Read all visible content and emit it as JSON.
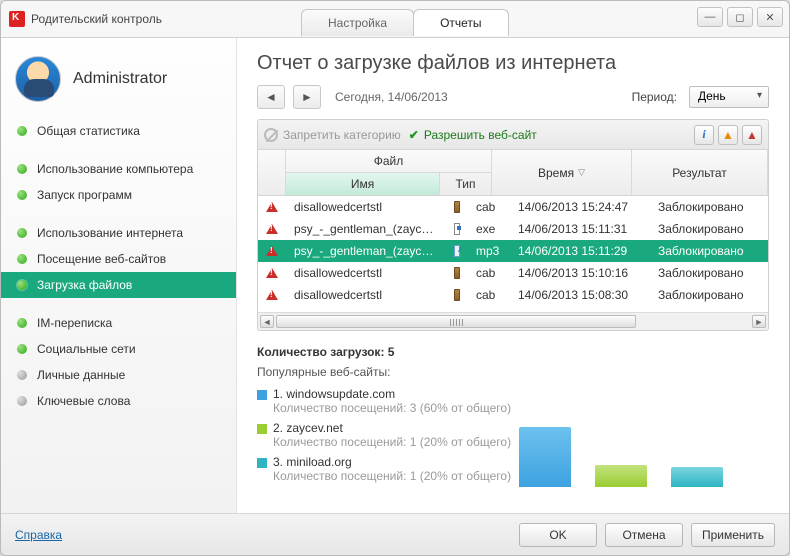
{
  "window": {
    "title": "Родительский контроль",
    "tabs": [
      {
        "label": "Настройка",
        "active": false
      },
      {
        "label": "Отчеты",
        "active": true
      }
    ]
  },
  "user": {
    "name": "Administrator"
  },
  "sidebar": {
    "items": [
      {
        "label": "Общая статистика",
        "status": "green",
        "gap": false
      },
      {
        "label": "Использование компьютера",
        "status": "green",
        "gap": true
      },
      {
        "label": "Запуск программ",
        "status": "green",
        "gap": false
      },
      {
        "label": "Использование интернета",
        "status": "green",
        "gap": true
      },
      {
        "label": "Посещение веб-сайтов",
        "status": "green",
        "gap": false
      },
      {
        "label": "Загрузка файлов",
        "status": "green",
        "gap": false,
        "active": true
      },
      {
        "label": "IM-переписка",
        "status": "green",
        "gap": true
      },
      {
        "label": "Социальные сети",
        "status": "green",
        "gap": false
      },
      {
        "label": "Личные данные",
        "status": "grey",
        "gap": false
      },
      {
        "label": "Ключевые слова",
        "status": "grey",
        "gap": false
      }
    ]
  },
  "report": {
    "title": "Отчет о загрузке файлов из интернета",
    "date_label": "Сегодня, 14/06/2013",
    "period_label": "Период:",
    "period_value": "День",
    "toolbar": {
      "block_category": "Запретить категорию",
      "allow_site": "Разрешить веб-сайт"
    },
    "columns": {
      "file": "Файл",
      "name": "Имя",
      "type": "Тип",
      "time": "Время",
      "result": "Результат"
    },
    "rows": [
      {
        "name": "disallowedcertstl",
        "icon": "cab",
        "type": "cab",
        "time": "14/06/2013 15:24:47",
        "result": "Заблокировано"
      },
      {
        "name": "psy_-_gentleman_(zaycev…",
        "icon": "exe",
        "type": "exe",
        "time": "14/06/2013 15:11:31",
        "result": "Заблокировано"
      },
      {
        "name": "psy_-_gentleman_(zaycev…",
        "icon": "mp3",
        "type": "mp3",
        "time": "14/06/2013 15:11:29",
        "result": "Заблокировано",
        "selected": true
      },
      {
        "name": "disallowedcertstl",
        "icon": "cab",
        "type": "cab",
        "time": "14/06/2013 15:10:16",
        "result": "Заблокировано"
      },
      {
        "name": "disallowedcertstl",
        "icon": "cab",
        "type": "cab",
        "time": "14/06/2013 15:08:30",
        "result": "Заблокировано"
      }
    ]
  },
  "summary": {
    "count_label": "Количество загрузок: 5",
    "popular_label": "Популярные веб-сайты:",
    "sites": [
      {
        "idx": "1.",
        "name": "windowsupdate.com",
        "meta": "Количество посещений: 3 (60% от общего)"
      },
      {
        "idx": "2.",
        "name": "zaycev.net",
        "meta": "Количество посещений: 1 (20% от общего)"
      },
      {
        "idx": "3.",
        "name": "miniload.org",
        "meta": "Количество посещений: 1 (20% от общего)"
      }
    ]
  },
  "chart_data": {
    "type": "bar",
    "categories": [
      "windowsupdate.com",
      "zaycev.net",
      "miniload.org"
    ],
    "values": [
      3,
      1,
      1
    ],
    "colors": [
      "#3da2e0",
      "#9acd32",
      "#2fb4c2"
    ],
    "title": "",
    "xlabel": "",
    "ylabel": ""
  },
  "footer": {
    "help": "Справка",
    "ok": "OK",
    "cancel": "Отмена",
    "apply": "Применить"
  }
}
